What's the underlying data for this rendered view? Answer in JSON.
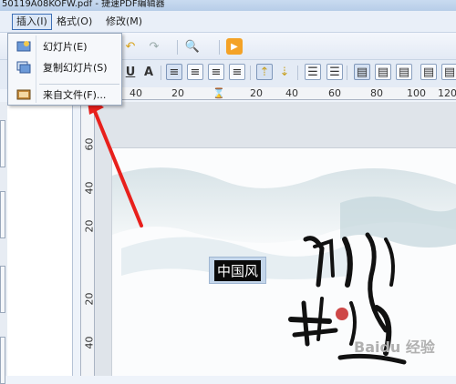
{
  "window": {
    "title": "50119A08KOFW.pdf - 捷速PDF编辑器"
  },
  "menubar": {
    "items": [
      {
        "label": "插入(I)",
        "active": true
      },
      {
        "label": "格式(O)",
        "active": false
      },
      {
        "label": "修改(M)",
        "active": false
      }
    ]
  },
  "insert_menu": {
    "items": [
      {
        "label": "幻灯片(E)",
        "icon": "slide-icon"
      },
      {
        "label": "复制幻灯片(S)",
        "icon": "duplicate-slide-icon"
      },
      {
        "label": "来自文件(F)...",
        "icon": "from-file-icon"
      }
    ]
  },
  "toolbar": {
    "underline_label": "U",
    "font_color_label": "A"
  },
  "horizontal_ruler": {
    "labels": [
      "40",
      "20",
      "20",
      "40",
      "60",
      "80",
      "100",
      "120"
    ]
  },
  "vertical_ruler": {
    "labels": [
      "60",
      "40",
      "20",
      "20",
      "40"
    ]
  },
  "slide": {
    "text_box": "中国风",
    "calligraphy_caption": "Baidu 经验"
  },
  "colors": {
    "menu_highlight": "#3d6fb6",
    "arrow_red": "#e8201c",
    "text_box_bg": "#c4d6ea"
  }
}
